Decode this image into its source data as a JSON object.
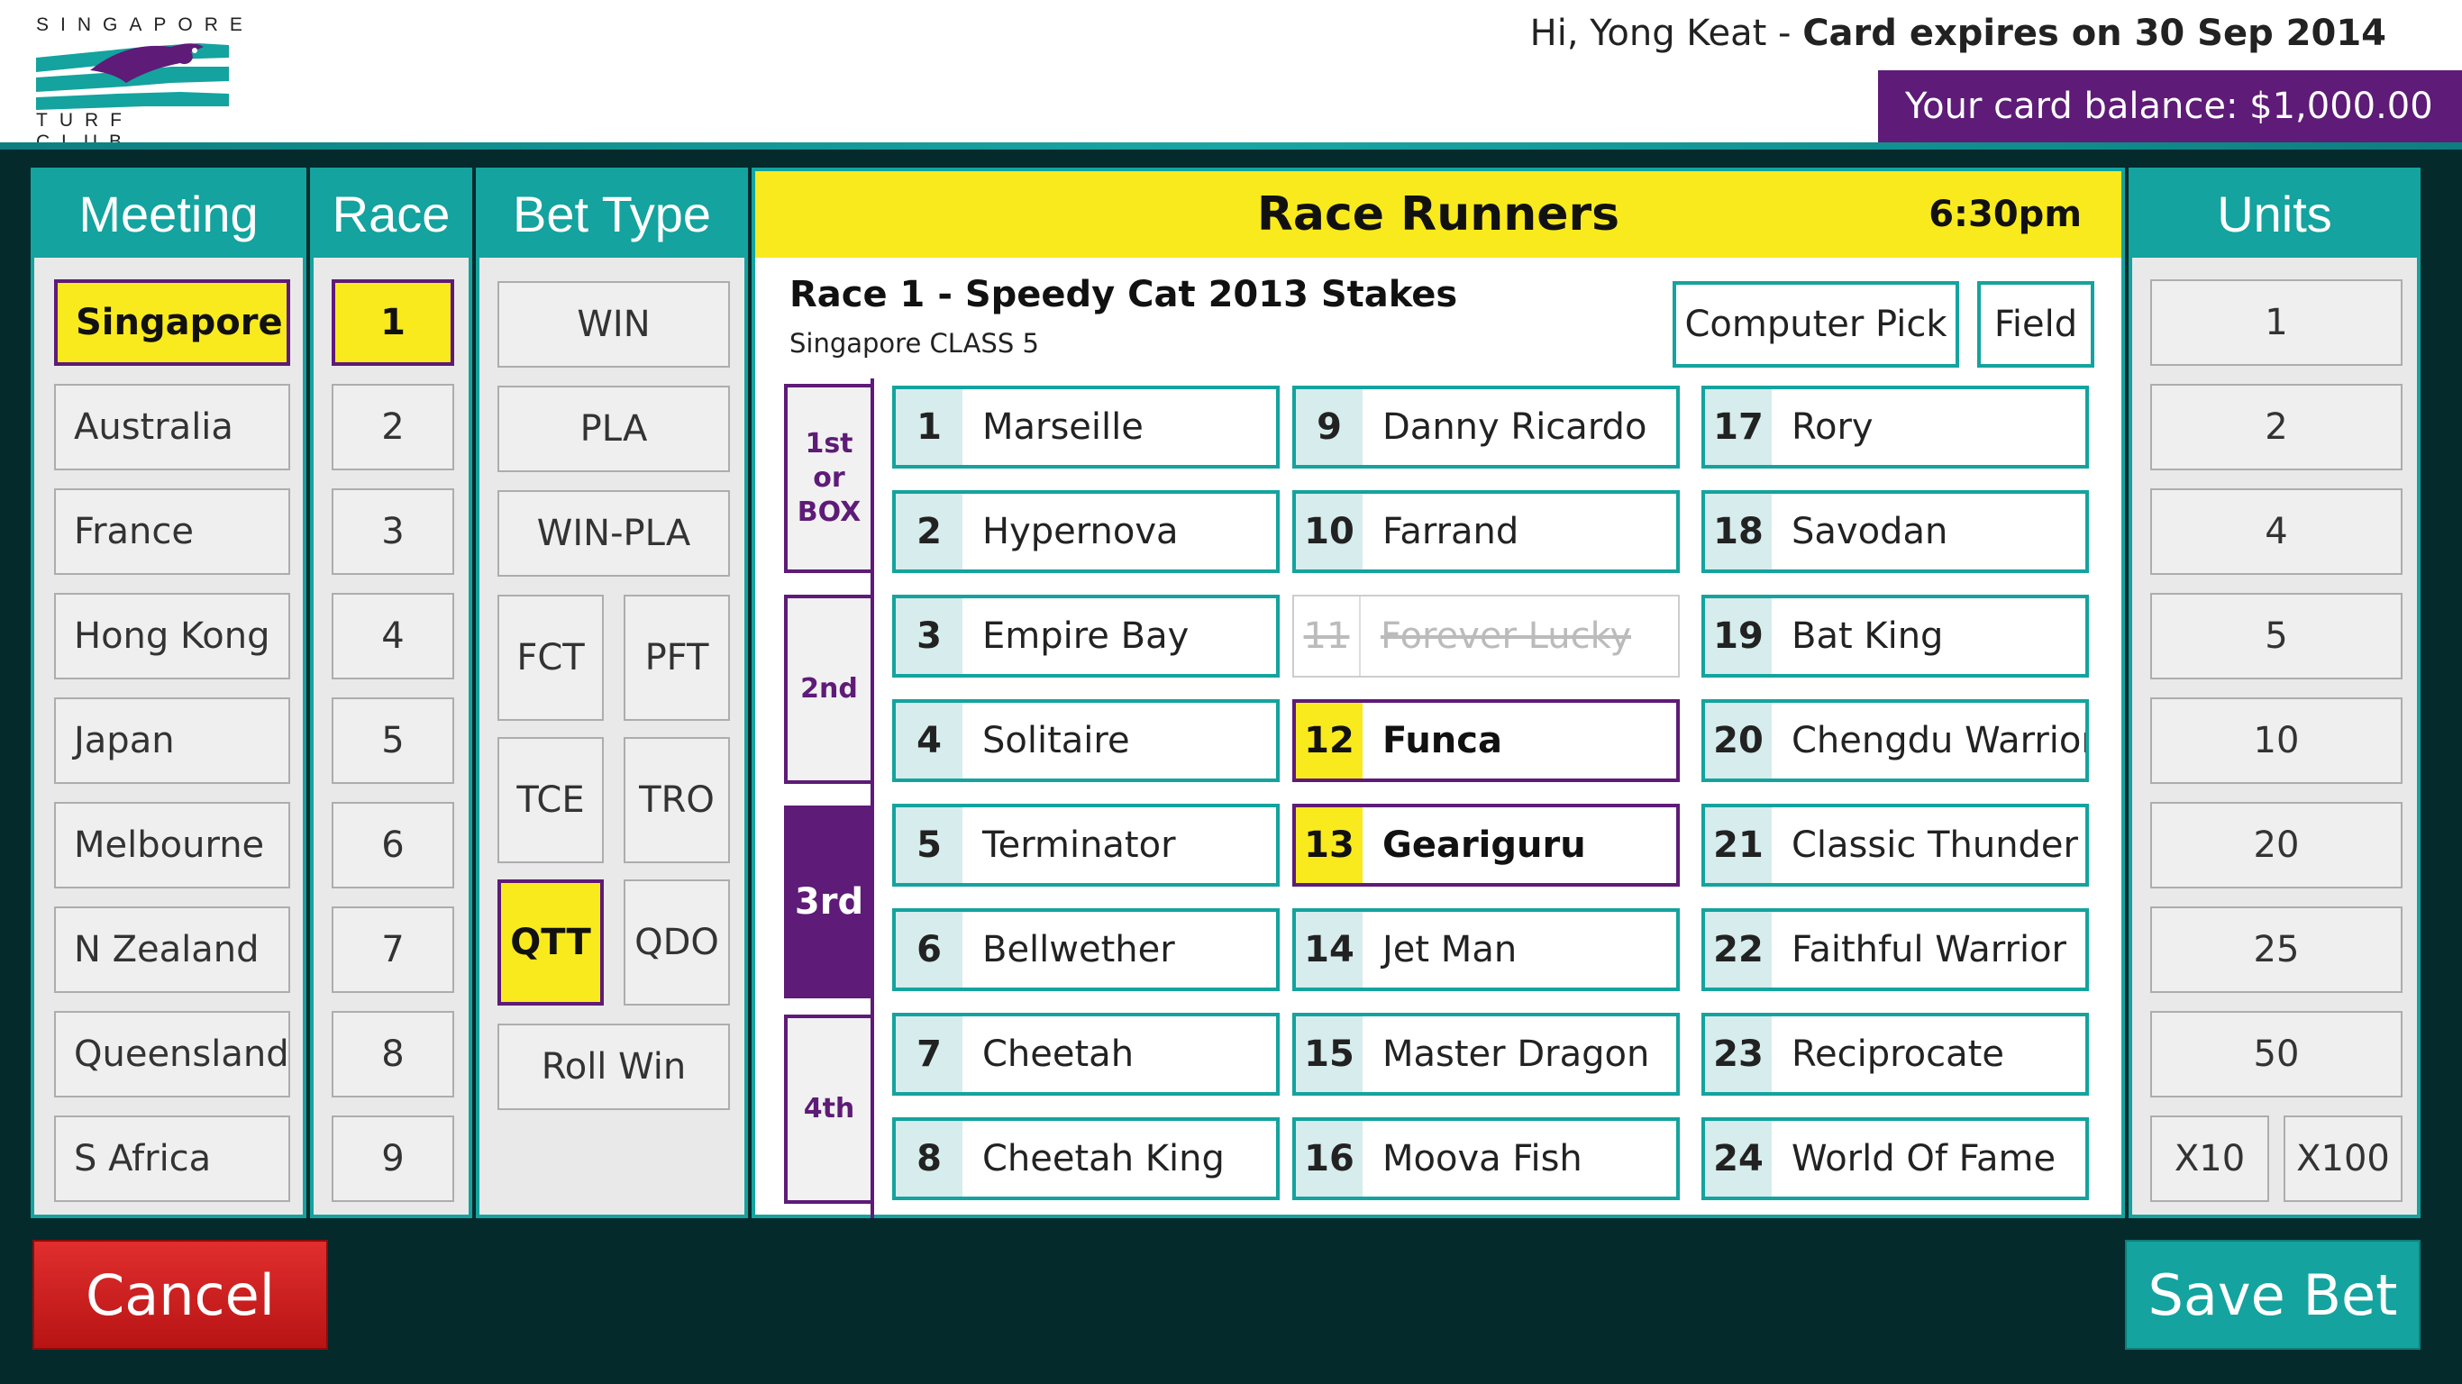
{
  "brand": {
    "line1": "SINGAPORE",
    "line2": "TURF CLUB"
  },
  "header": {
    "greeting": "Hi, Yong Keat - ",
    "card_expiry": "Card expires on 30 Sep 2014",
    "balance": "Your card balance: $1,000.00"
  },
  "meeting": {
    "title": "Meeting",
    "items": [
      "Singapore",
      "Australia",
      "France",
      "Hong Kong",
      "Japan",
      "Melbourne",
      "N Zealand",
      "Queensland",
      "S Africa"
    ],
    "selected": "Singapore"
  },
  "race": {
    "title": "Race",
    "items": [
      "1",
      "2",
      "3",
      "4",
      "5",
      "6",
      "7",
      "8",
      "9"
    ],
    "selected": "1"
  },
  "bet_type": {
    "title": "Bet Type",
    "win": "WIN",
    "pla": "PLA",
    "win_pla": "WIN-PLA",
    "fct": "FCT",
    "pft": "PFT",
    "tce": "TCE",
    "tro": "TRO",
    "qtt": "QTT",
    "qdo": "QDO",
    "roll_win": "Roll Win",
    "selected": "QTT"
  },
  "race_runners": {
    "title": "Race Runners",
    "time": "6:30pm",
    "race_name": "Race 1 - Speedy Cat 2013 Stakes",
    "race_class": "Singapore CLASS 5",
    "computer_pick": "Computer Pick",
    "field": "Field",
    "positions": [
      "1st\nor\nBOX",
      "2nd",
      "3rd",
      "4th"
    ],
    "selected_position": "3rd",
    "runners": [
      {
        "num": "1",
        "name": "Marseille"
      },
      {
        "num": "2",
        "name": "Hypernova"
      },
      {
        "num": "3",
        "name": "Empire Bay"
      },
      {
        "num": "4",
        "name": "Solitaire"
      },
      {
        "num": "5",
        "name": "Terminator"
      },
      {
        "num": "6",
        "name": "Bellwether"
      },
      {
        "num": "7",
        "name": "Cheetah"
      },
      {
        "num": "8",
        "name": "Cheetah King"
      },
      {
        "num": "9",
        "name": "Danny Ricardo"
      },
      {
        "num": "10",
        "name": "Farrand"
      },
      {
        "num": "11",
        "name": "Forever Lucky",
        "scratched": true
      },
      {
        "num": "12",
        "name": "Funca",
        "selected": true
      },
      {
        "num": "13",
        "name": "Geariguru",
        "selected": true
      },
      {
        "num": "14",
        "name": "Jet Man"
      },
      {
        "num": "15",
        "name": "Master Dragon"
      },
      {
        "num": "16",
        "name": "Moova Fish"
      },
      {
        "num": "17",
        "name": "Rory"
      },
      {
        "num": "18",
        "name": "Savodan"
      },
      {
        "num": "19",
        "name": "Bat King"
      },
      {
        "num": "20",
        "name": "Chengdu Warrior"
      },
      {
        "num": "21",
        "name": "Classic Thunder"
      },
      {
        "num": "22",
        "name": "Faithful Warrior"
      },
      {
        "num": "23",
        "name": "Reciprocate"
      },
      {
        "num": "24",
        "name": "World Of Fame"
      }
    ]
  },
  "units": {
    "title": "Units",
    "items": [
      "1",
      "2",
      "4",
      "5",
      "10",
      "20",
      "25",
      "50"
    ],
    "x10": "X10",
    "x100": "X100"
  },
  "actions": {
    "cancel": "Cancel",
    "save": "Save Bet"
  },
  "colors": {
    "teal": "#14a39e",
    "purple": "#5e1b77",
    "yellow": "#f9ea1e",
    "red": "#d42020",
    "background": "#042a2c"
  }
}
